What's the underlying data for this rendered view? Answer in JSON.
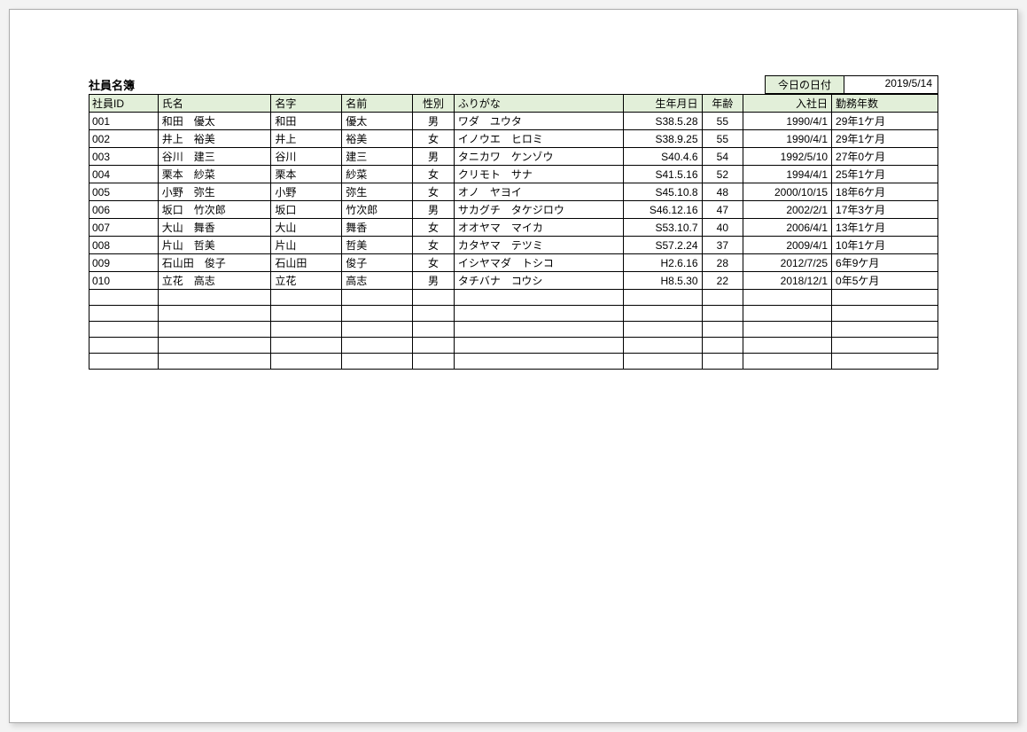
{
  "title": "社員名簿",
  "date_label": "今日の日付",
  "date_value": "2019/5/14",
  "headers": {
    "id": "社員ID",
    "name": "氏名",
    "surname": "名字",
    "firstname": "名前",
    "gender": "性別",
    "kana": "ふりがな",
    "birth": "生年月日",
    "age": "年齢",
    "hire": "入社日",
    "tenure": "勤務年数"
  },
  "rows": [
    {
      "id": "001",
      "name": "和田　優太",
      "surname": "和田",
      "firstname": "優太",
      "gender": "男",
      "kana": "ワダ　ユウタ",
      "birth": "S38.5.28",
      "age": "55",
      "hire": "1990/4/1",
      "tenure": "29年1ケ月"
    },
    {
      "id": "002",
      "name": "井上　裕美",
      "surname": "井上",
      "firstname": "裕美",
      "gender": "女",
      "kana": "イノウエ　ヒロミ",
      "birth": "S38.9.25",
      "age": "55",
      "hire": "1990/4/1",
      "tenure": "29年1ケ月"
    },
    {
      "id": "003",
      "name": "谷川　建三",
      "surname": "谷川",
      "firstname": "建三",
      "gender": "男",
      "kana": "タニカワ　ケンゾウ",
      "birth": "S40.4.6",
      "age": "54",
      "hire": "1992/5/10",
      "tenure": "27年0ケ月"
    },
    {
      "id": "004",
      "name": "栗本　紗菜",
      "surname": "栗本",
      "firstname": "紗菜",
      "gender": "女",
      "kana": "クリモト　サナ",
      "birth": "S41.5.16",
      "age": "52",
      "hire": "1994/4/1",
      "tenure": "25年1ケ月"
    },
    {
      "id": "005",
      "name": "小野　弥生",
      "surname": "小野",
      "firstname": "弥生",
      "gender": "女",
      "kana": "オノ　ヤヨイ",
      "birth": "S45.10.8",
      "age": "48",
      "hire": "2000/10/15",
      "tenure": "18年6ケ月"
    },
    {
      "id": "006",
      "name": "坂口　竹次郎",
      "surname": "坂口",
      "firstname": "竹次郎",
      "gender": "男",
      "kana": "サカグチ　タケジロウ",
      "birth": "S46.12.16",
      "age": "47",
      "hire": "2002/2/1",
      "tenure": "17年3ケ月"
    },
    {
      "id": "007",
      "name": "大山　舞香",
      "surname": "大山",
      "firstname": "舞香",
      "gender": "女",
      "kana": "オオヤマ　マイカ",
      "birth": "S53.10.7",
      "age": "40",
      "hire": "2006/4/1",
      "tenure": "13年1ケ月"
    },
    {
      "id": "008",
      "name": "片山　哲美",
      "surname": "片山",
      "firstname": "哲美",
      "gender": "女",
      "kana": "カタヤマ　テツミ",
      "birth": "S57.2.24",
      "age": "37",
      "hire": "2009/4/1",
      "tenure": "10年1ケ月"
    },
    {
      "id": "009",
      "name": "石山田　俊子",
      "surname": "石山田",
      "firstname": "俊子",
      "gender": "女",
      "kana": "イシヤマダ　トシコ",
      "birth": "H2.6.16",
      "age": "28",
      "hire": "2012/7/25",
      "tenure": "6年9ケ月"
    },
    {
      "id": "010",
      "name": "立花　高志",
      "surname": "立花",
      "firstname": "高志",
      "gender": "男",
      "kana": "タチバナ　コウシ",
      "birth": "H8.5.30",
      "age": "22",
      "hire": "2018/12/1",
      "tenure": "0年5ケ月"
    }
  ],
  "empty_rows": 5
}
